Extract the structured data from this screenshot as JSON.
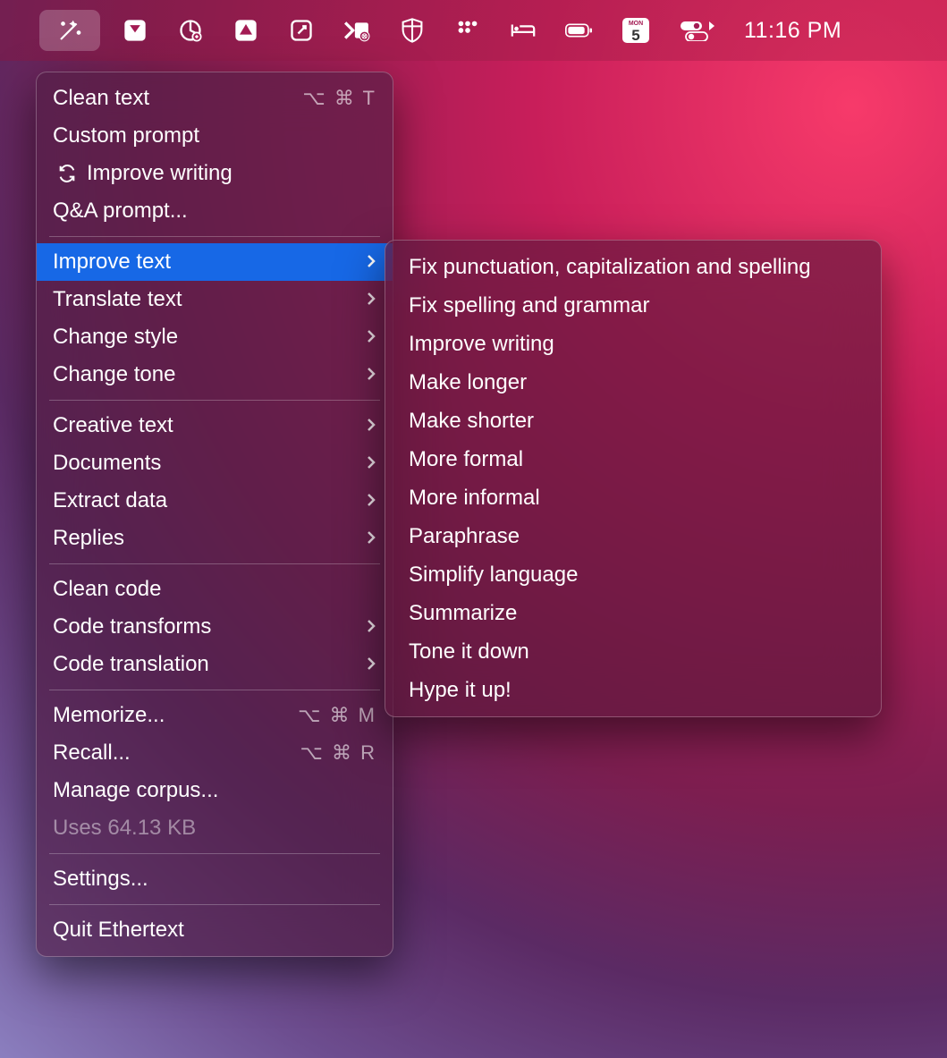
{
  "menubar": {
    "clock": "11:16 PM",
    "calendar_day": "5",
    "calendar_dow": "MON"
  },
  "menu": {
    "items": [
      {
        "label": "Clean text",
        "shortcut": "⌥ ⌘ T"
      },
      {
        "label": "Custom prompt"
      },
      {
        "label": "Improve writing",
        "icon": "refresh"
      },
      {
        "label": "Q&A prompt..."
      }
    ],
    "submenu_items": [
      {
        "label": "Improve text",
        "chev": true,
        "hl": true
      },
      {
        "label": "Translate text",
        "chev": true
      },
      {
        "label": "Change style",
        "chev": true
      },
      {
        "label": "Change tone",
        "chev": true
      }
    ],
    "creative_items": [
      {
        "label": "Creative text",
        "chev": true
      },
      {
        "label": "Documents",
        "chev": true
      },
      {
        "label": "Extract data",
        "chev": true
      },
      {
        "label": "Replies",
        "chev": true
      }
    ],
    "code_items": [
      {
        "label": "Clean code"
      },
      {
        "label": "Code transforms",
        "chev": true
      },
      {
        "label": "Code translation",
        "chev": true
      }
    ],
    "memory_items": [
      {
        "label": "Memorize...",
        "shortcut": "⌥ ⌘ M"
      },
      {
        "label": "Recall...",
        "shortcut": "⌥ ⌘ R"
      },
      {
        "label": "Manage corpus..."
      },
      {
        "label": "Uses 64.13 KB",
        "disabled": true
      }
    ],
    "bottom_items": [
      {
        "label": "Settings..."
      }
    ],
    "quit_items": [
      {
        "label": "Quit Ethertext"
      }
    ]
  },
  "submenu": {
    "items": [
      "Fix punctuation, capitalization and spelling",
      "Fix spelling and grammar",
      "Improve writing",
      "Make longer",
      "Make shorter",
      "More formal",
      "More informal",
      "Paraphrase",
      "Simplify language",
      "Summarize",
      "Tone it down",
      "Hype it up!"
    ]
  }
}
